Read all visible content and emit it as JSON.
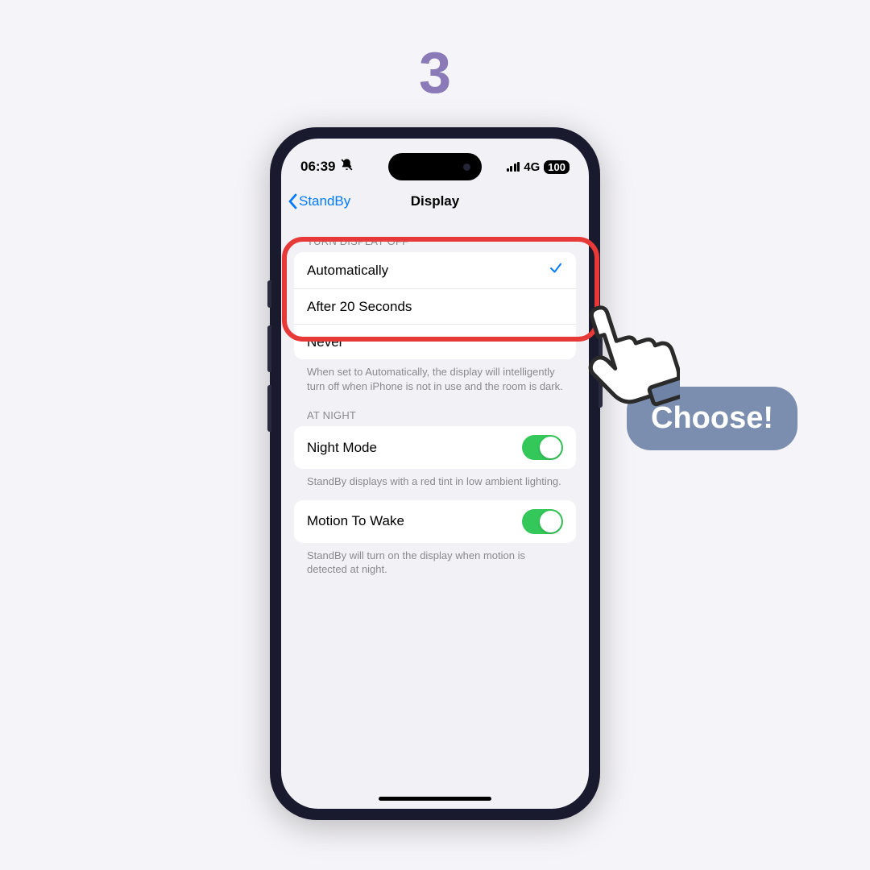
{
  "step_number": "3",
  "status": {
    "time": "06:39",
    "bell_icon": "bell-slash-icon",
    "network": "4G",
    "battery": "100"
  },
  "nav": {
    "back_label": "StandBy",
    "title": "Display"
  },
  "section_turn_off": {
    "header": "TURN DISPLAY OFF",
    "options": [
      {
        "label": "Automatically",
        "selected": true
      },
      {
        "label": "After 20 Seconds",
        "selected": false
      },
      {
        "label": "Never",
        "selected": false
      }
    ],
    "footer": "When set to Automatically, the display will intelligently turn off when iPhone is not in use and the room is dark."
  },
  "section_night": {
    "header": "AT NIGHT",
    "night_mode_label": "Night Mode",
    "night_mode_footer": "StandBy displays with a red tint in low ambient lighting.",
    "motion_label": "Motion To Wake",
    "motion_footer": "StandBy will turn on the display when motion is detected at night."
  },
  "callout": {
    "text": "Choose!"
  }
}
